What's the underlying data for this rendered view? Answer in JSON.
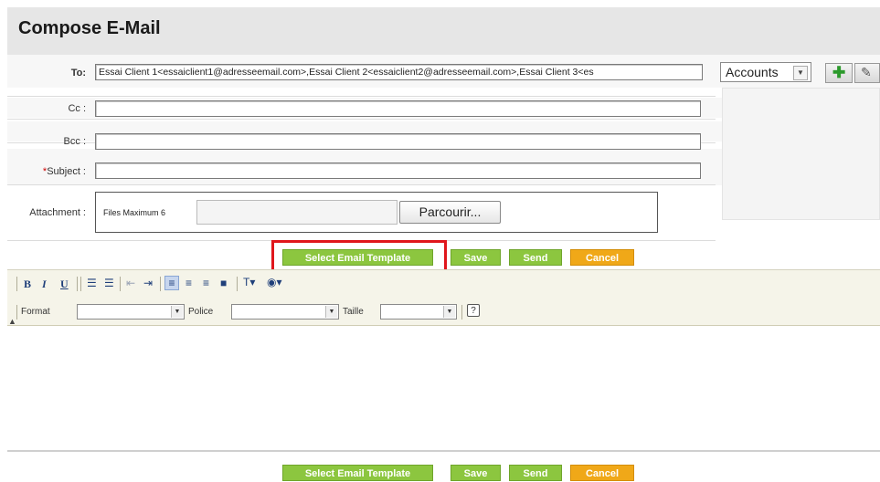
{
  "header": {
    "title": "Compose E-Mail"
  },
  "form": {
    "to_label": "To:",
    "to_value": "Essai Client 1<essaiclient1@adresseemail.com>,Essai Client 2<essaiclient2@adresseemail.com>,Essai Client 3<es",
    "cc_label": "Cc :",
    "cc_value": "",
    "bcc_label": "Bcc :",
    "bcc_value": "",
    "subject_required_mark": "*",
    "subject_label": "Subject :",
    "subject_value": "",
    "attachment_label": "Attachment :",
    "files_max_text": "Files Maximum 6",
    "browse_label": "Parcourir..."
  },
  "accounts": {
    "selected": "Accounts"
  },
  "actions": {
    "select_template": "Select Email Template",
    "save": "Save",
    "send": "Send",
    "cancel": "Cancel"
  },
  "toolbar": {
    "bold": "B",
    "italic": "I",
    "underline": "U",
    "format_label": "Format",
    "format_value": "",
    "font_label": "Police",
    "font_value": "",
    "size_label": "Taille",
    "size_value": "",
    "help": "?"
  },
  "colors": {
    "action_green": "#8cc63f",
    "action_orange": "#f0a818",
    "highlight_red": "#e0161c",
    "toolbar_bg": "#f5f4e9"
  },
  "icons": [
    "ordered-list-icon",
    "unordered-list-icon",
    "outdent-icon",
    "indent-icon",
    "align-left-icon",
    "align-center-icon",
    "align-right-icon",
    "justify-icon",
    "text-color-icon",
    "background-color-icon",
    "help-icon",
    "add-contact-icon",
    "edit-contact-icon"
  ]
}
